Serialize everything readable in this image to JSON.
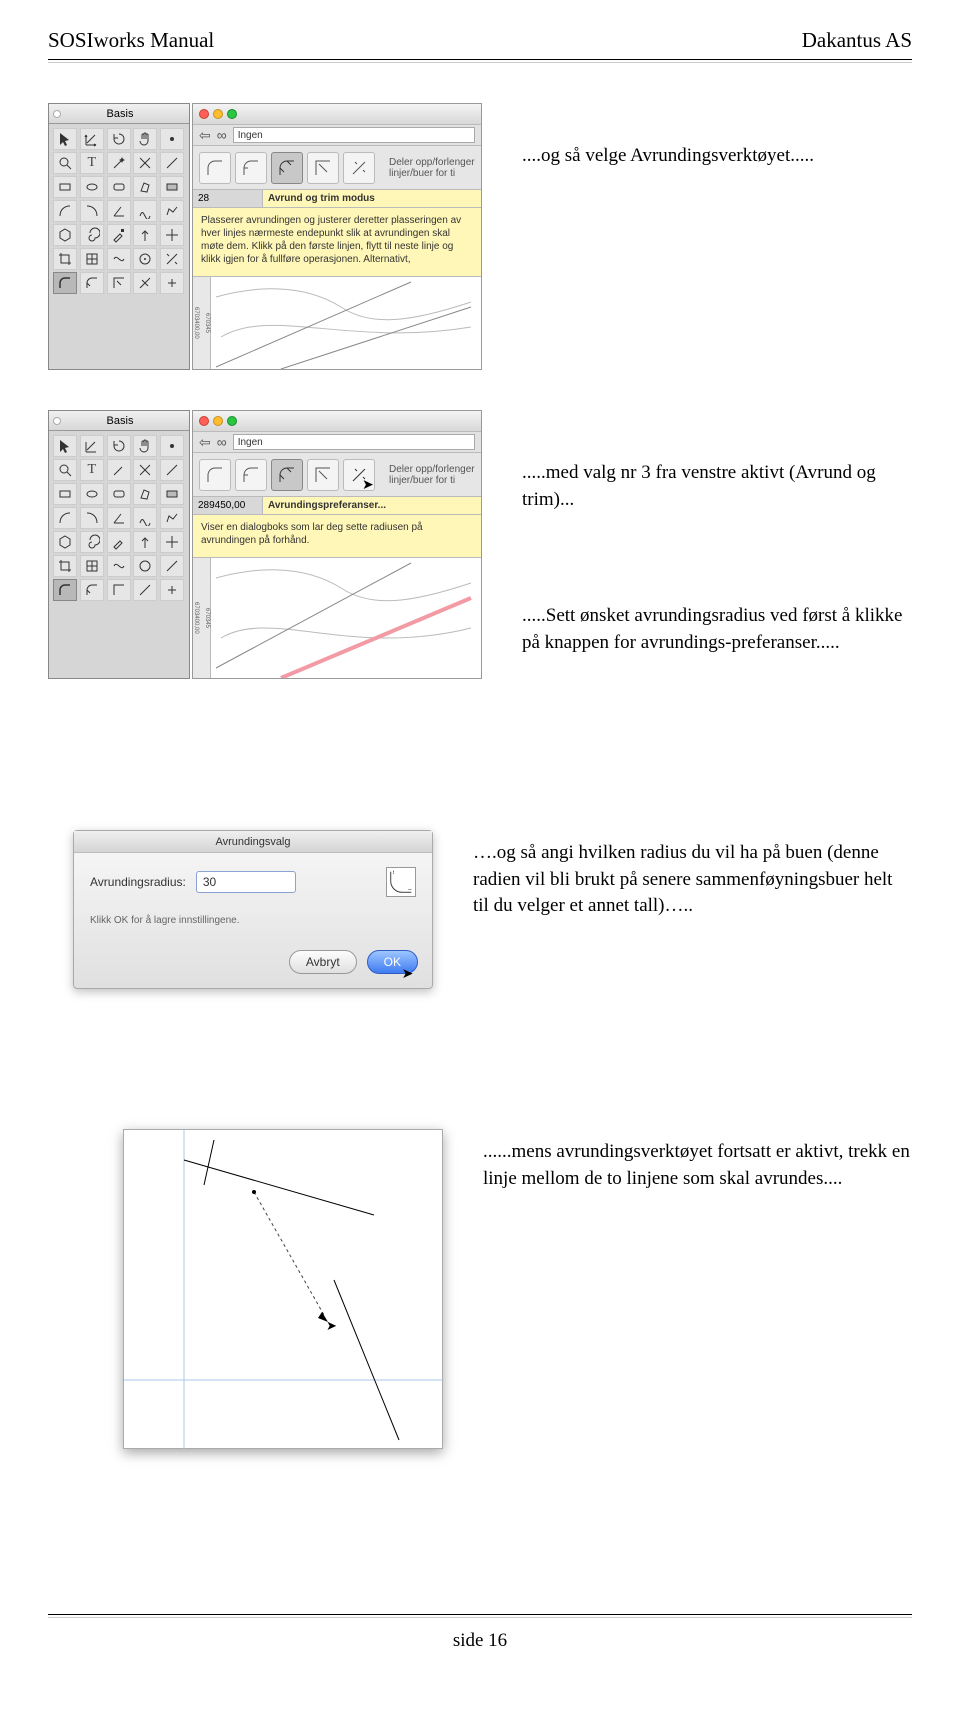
{
  "header": {
    "left": "SOSIworks Manual",
    "right": "Dakantus AS"
  },
  "row1_caption": "....og så velge Avrundingsverktøyet.....",
  "row2_caption_a": ".....med valg nr 3 fra venstre aktivt (Avrund og trim)...",
  "row2_caption_b": ".....Sett ønsket avrundingsradius ved først å klikke på knappen for avrundings-preferanser.....",
  "row3_caption": "….og så angi hvilken radius du vil ha på buen (denne radien vil bli brukt på senere sammenføyningsbuer helt til du velger et annet tall)…..",
  "row4_caption": "......mens avrundingsverktøyet fortsatt er aktivt, trekk en linje mellom de to linjene som skal avrundes....",
  "footer": "side 16",
  "palette": {
    "title": "Basis"
  },
  "mainwin": {
    "ingen_label": "Ingen",
    "ruler": [
      "670345",
      "6703400,00"
    ]
  },
  "tip1": {
    "tip_line": "Deler opp/forlenger linjer/buer for ti",
    "coord": "28",
    "title": "Avrund og trim modus",
    "body": "Plasserer avrundingen og justerer deretter plasseringen av hver linjes nærmeste endepunkt slik at avrundingen skal møte dem. Klikk på den første linjen, flytt til neste linje og klikk igjen for å fullføre operasjonen. Alternativt,"
  },
  "tip2": {
    "tip_line": "Deler opp/forlenger linjer/buer for ti",
    "coord": "289450,00",
    "title": "Avrundingspreferanser...",
    "body": "Viser en dialogboks som lar deg sette radiusen på avrundingen på forhånd."
  },
  "dialog": {
    "title": "Avrundingsvalg",
    "radius_label": "Avrundingsradius:",
    "radius_value": "30",
    "note": "Klikk OK for å lagre innstillingene.",
    "btn_cancel": "Avbryt",
    "btn_ok": "OK"
  }
}
